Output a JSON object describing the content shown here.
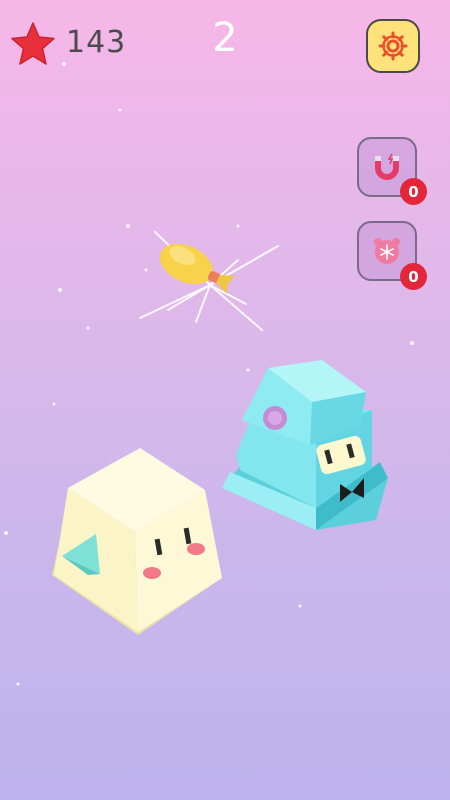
{
  "hud": {
    "star_count": "143",
    "level_number": "2",
    "settings_icon": "gear-icon",
    "star_icon": "star-icon"
  },
  "powerups": [
    {
      "icon": "magnet-icon",
      "count": "0"
    },
    {
      "icon": "freeze-icon",
      "count": "0"
    }
  ],
  "characters": {
    "player": "yellow-cube-character",
    "enemy": "cyan-block-character",
    "projectile": "yellow-rocket"
  },
  "colors": {
    "accent_star": "#e8303b",
    "settings_bg": "#ffe37a",
    "badge": "#e3263a",
    "player_cube": "#fdf8cf",
    "enemy_block": "#7fe3ec"
  }
}
